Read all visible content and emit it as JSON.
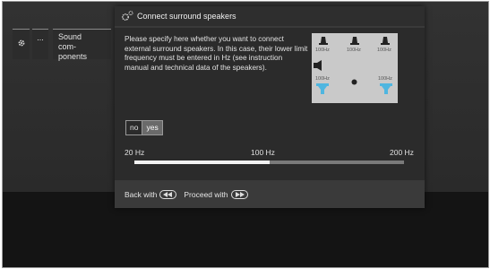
{
  "breadcrumb": {
    "gear_icon": "gear-icon",
    "more": "...",
    "sound_components": "Sound com- ponents"
  },
  "dialog": {
    "title": "Connect surround speakers",
    "description": "Please specify here whether you want to connect external surround speakers. In this case, their lower limit frequency must be entered in Hz (see instruction manual and technical data of the speakers).",
    "speaker_labels": {
      "front_left": "100Hz",
      "center": "100Hz",
      "front_right": "100Hz",
      "side": "100Hz",
      "surround_left": "100Hz",
      "surround_right": "100Hz"
    },
    "toggle": {
      "options": [
        "no",
        "yes"
      ],
      "selected": "yes"
    },
    "frequency": {
      "min_label": "20 Hz",
      "mid_label": "100 Hz",
      "max_label": "200 Hz",
      "value_hz": 100,
      "min_hz": 20,
      "max_hz": 200
    },
    "footer": {
      "back_label": "Back with",
      "proceed_label": "Proceed with"
    }
  },
  "colors": {
    "panel": "#2b2b2b",
    "header": "#2e2e2e",
    "accent_blue": "#4fb6e0"
  }
}
